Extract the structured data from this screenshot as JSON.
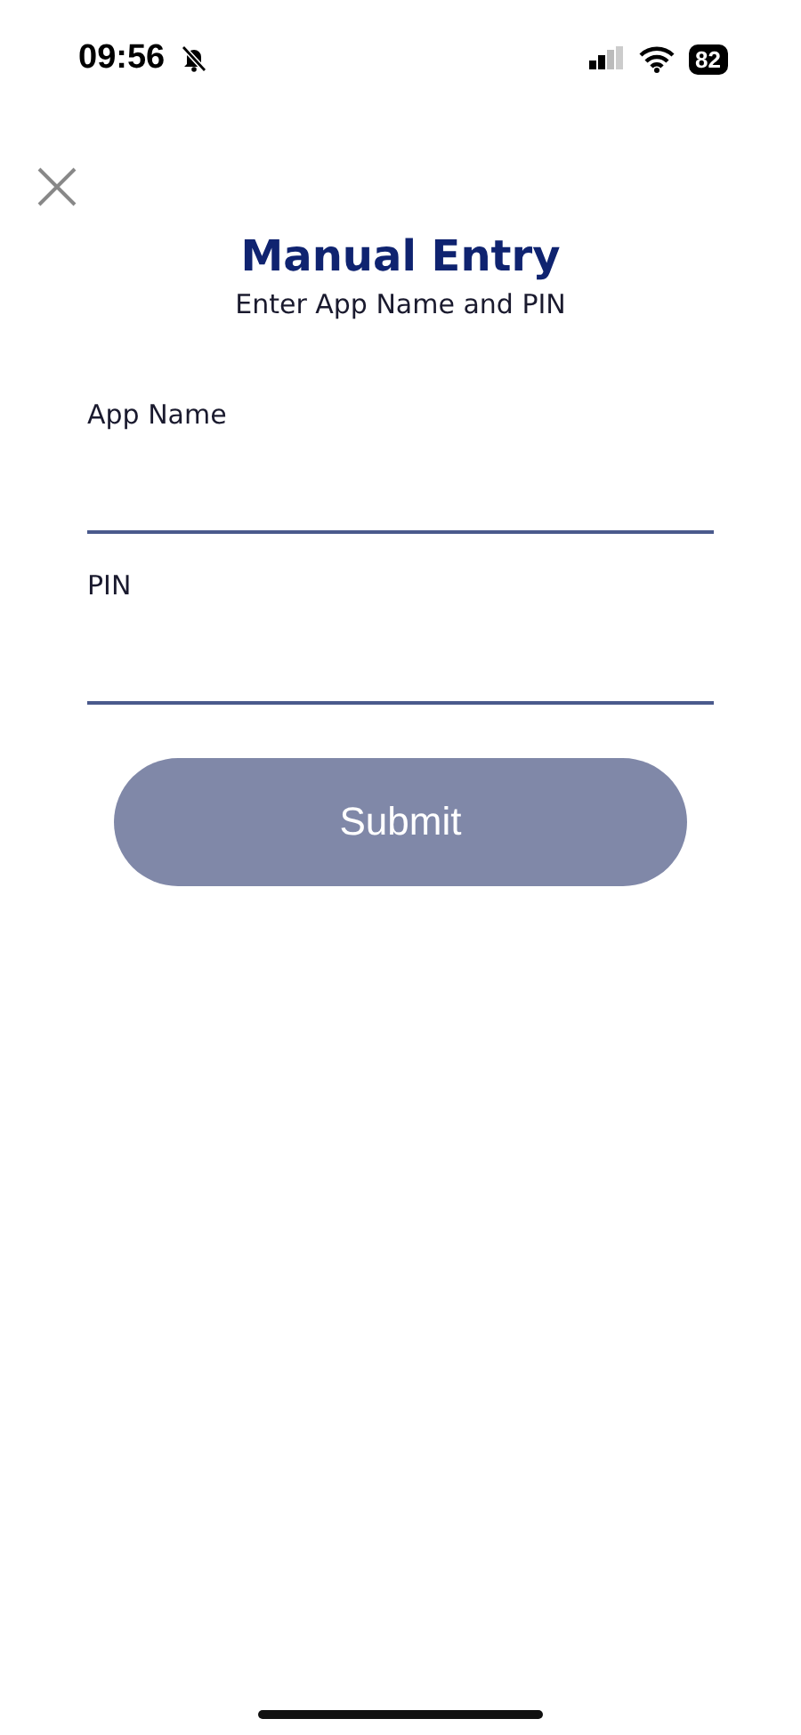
{
  "status_bar": {
    "time": "09:56",
    "silent": true,
    "battery": "82"
  },
  "header": {
    "title": "Manual Entry",
    "subtitle": "Enter App Name and PIN"
  },
  "fields": [
    {
      "label": "App Name"
    },
    {
      "label": "PIN"
    }
  ],
  "submit": {
    "label": "Submit",
    "disabled": true
  }
}
